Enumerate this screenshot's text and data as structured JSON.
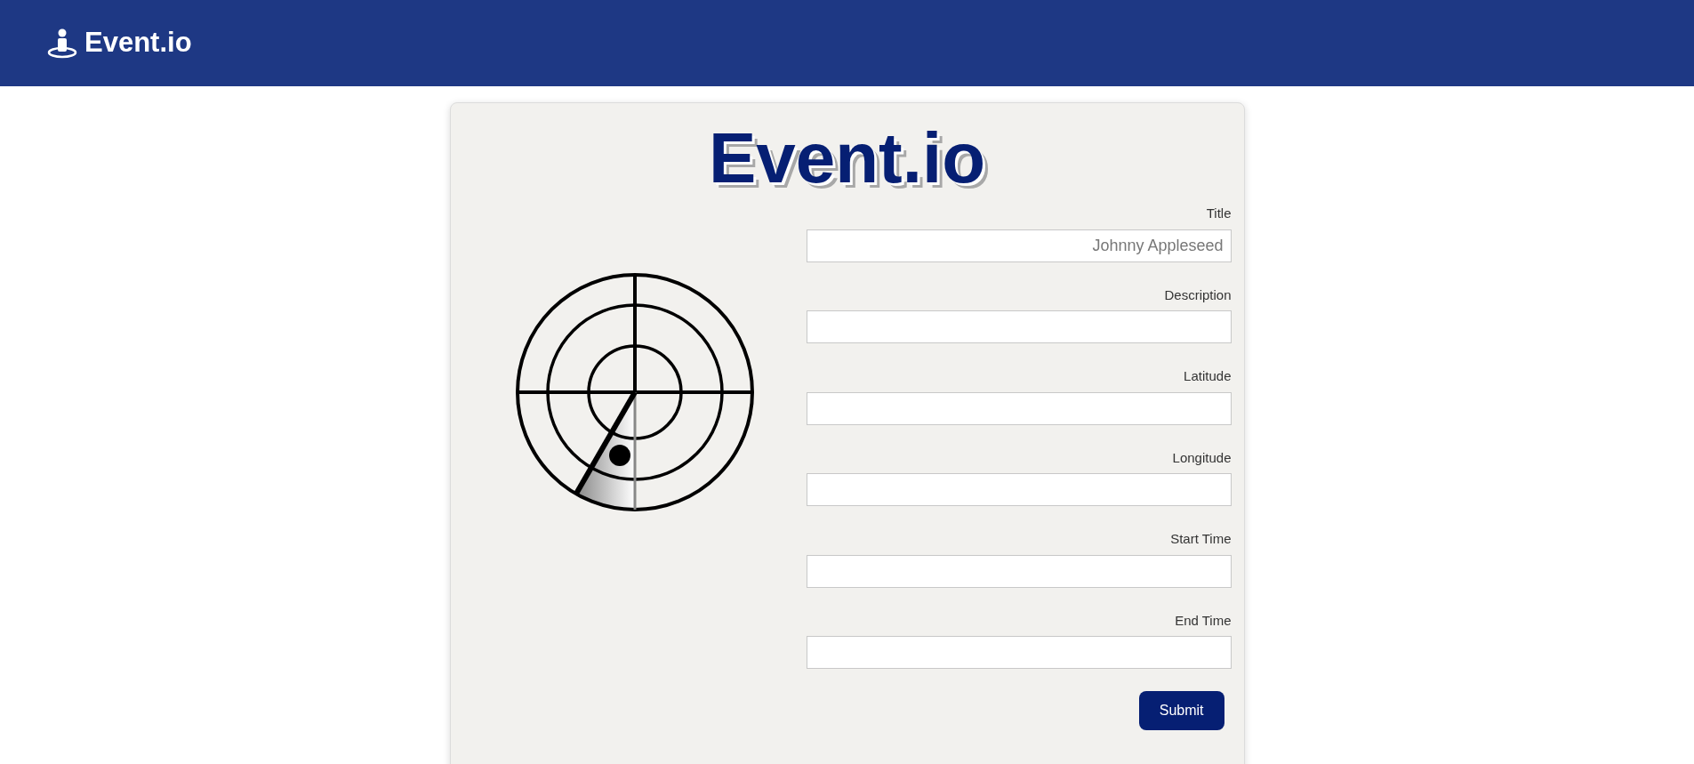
{
  "navbar": {
    "brand": "Event.io"
  },
  "form": {
    "heading": "Event.io",
    "fields": [
      {
        "label": "Title",
        "placeholder": "Johnny Appleseed"
      },
      {
        "label": "Description"
      },
      {
        "label": "Latitude"
      },
      {
        "label": "Longitude"
      },
      {
        "label": "Start Time"
      },
      {
        "label": "End Time"
      }
    ],
    "submit": "Submit"
  }
}
